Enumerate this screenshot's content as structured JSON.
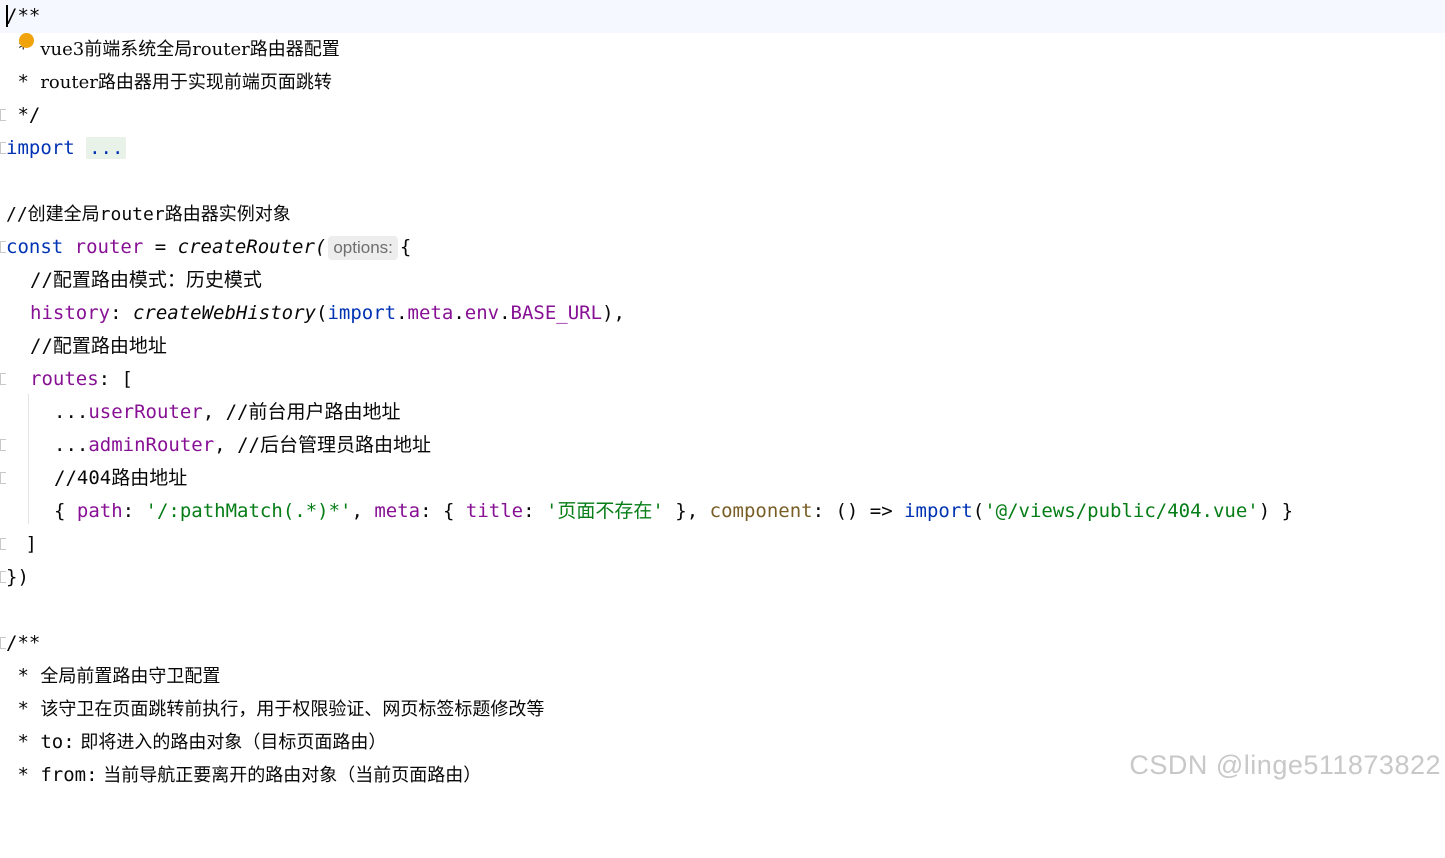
{
  "lines": {
    "l1": "/**",
    "l2_star": " * ",
    "l2_text": "vue3前端系统全局router路由器配置",
    "l3_star": " * ",
    "l3_text": "router路由器用于实现前端页面跳转",
    "l4": " */",
    "l5_kw": "import",
    "l5_fold": "...",
    "l7": "//创建全局router路由器实例对象",
    "l8_const": "const",
    "l8_var": "router",
    "l8_eq": " = ",
    "l8_fn": "createRouter(",
    "l8_hint": "options:",
    "l8_brace": "{",
    "l9": "//配置路由模式：历史模式",
    "l10_prop": "history",
    "l10_colon": ": ",
    "l10_fn": "createWebHistory",
    "l10_open": "(",
    "l10_import": "import",
    "l10_dot1": ".",
    "l10_meta": "meta",
    "l10_dot2": ".",
    "l10_env": "env",
    "l10_dot3": ".",
    "l10_base": "BASE_URL",
    "l10_close": "),",
    "l11": "//配置路由地址",
    "l12_prop": "routes",
    "l12_rest": ": [",
    "l13_spread": "...",
    "l13_name": "userRouter",
    "l13_comma": ", ",
    "l13_comment": "//前台用户路由地址",
    "l14_spread": "...",
    "l14_name": "adminRouter",
    "l14_comma": ", ",
    "l14_comment": "//后台管理员路由地址",
    "l15": "//404路由地址",
    "l16_open": "{ ",
    "l16_path": "path",
    "l16_c1": ": ",
    "l16_pathval": "'/:pathMatch(.*)*'",
    "l16_c2": ", ",
    "l16_meta": "meta",
    "l16_c3": ": { ",
    "l16_title": "title",
    "l16_c4": ": ",
    "l16_titleval": "'页面不存在'",
    "l16_c5": " }, ",
    "l16_component": "component",
    "l16_c6": ": () => ",
    "l16_import": "import",
    "l16_c7": "(",
    "l16_importval": "'@/views/public/404.vue'",
    "l16_c8": ") }",
    "l17": " ]",
    "l18": "})",
    "l20": "/**",
    "l21_star": " * ",
    "l21_text": "全局前置路由守卫配置",
    "l22_star": " * ",
    "l22_text": "该守卫在页面跳转前执行，用于权限验证、网页标签标题修改等",
    "l23_star": " * ",
    "l23_key": "to:",
    "l23_text": " 即将进入的路由对象（目标页面路由）",
    "l24_star": " * ",
    "l24_key": "from:",
    "l24_text": " 当前导航正要离开的路由对象（当前页面路由）"
  },
  "watermark": "CSDN @linge511873822",
  "icons": {
    "bulb": "lightbulb-icon",
    "fold": "fold-marker-icon"
  },
  "colors": {
    "keyword": "#0033b3",
    "property": "#871094",
    "string": "#067d17",
    "comment": "#8c8c8c",
    "bulb": "#f0a30a"
  }
}
